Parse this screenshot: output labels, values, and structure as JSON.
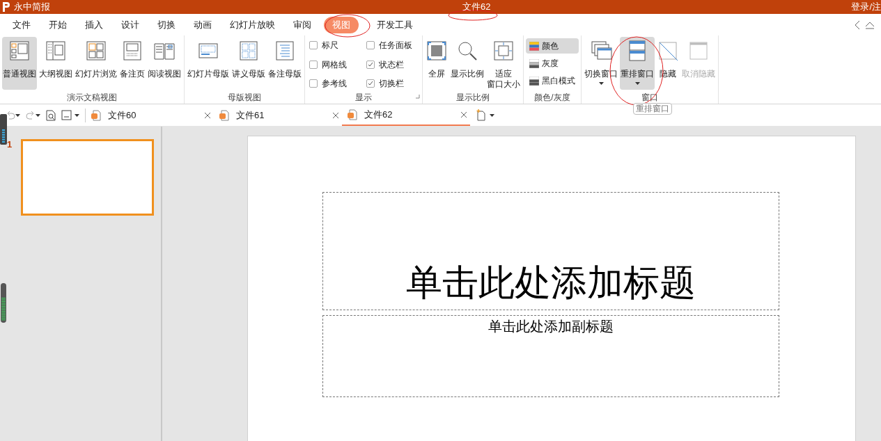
{
  "title_bar": {
    "app_name": "永中简报",
    "document_title": "文件62",
    "account_link": "登录/注"
  },
  "menu_tabs": [
    {
      "label": "文件",
      "selected": false
    },
    {
      "label": "开始",
      "selected": false
    },
    {
      "label": "插入",
      "selected": false
    },
    {
      "label": "设计",
      "selected": false
    },
    {
      "label": "切换",
      "selected": false
    },
    {
      "label": "动画",
      "selected": false
    },
    {
      "label": "幻灯片放映",
      "selected": false
    },
    {
      "label": "审阅",
      "selected": false
    },
    {
      "label": "视图",
      "selected": true
    },
    {
      "label": "开发工具",
      "selected": false
    }
  ],
  "ribbon": {
    "groups": [
      {
        "label": "演示文稿视图",
        "kind": "buttons",
        "items": [
          {
            "label": "普通视图",
            "selected": true
          },
          {
            "label": "大纲视图",
            "selected": false
          },
          {
            "label": "幻灯片浏览",
            "selected": false
          },
          {
            "label": "备注页",
            "selected": false
          },
          {
            "label": "阅读视图",
            "selected": false
          }
        ]
      },
      {
        "label": "母版视图",
        "kind": "buttons",
        "items": [
          {
            "label": "幻灯片母版",
            "selected": false
          },
          {
            "label": "讲义母版",
            "selected": false
          },
          {
            "label": "备注母版",
            "selected": false
          }
        ]
      },
      {
        "label": "显示",
        "kind": "checks",
        "items": [
          {
            "label": "标尺",
            "checked": false
          },
          {
            "label": "任务面板",
            "checked": false
          },
          {
            "label": "网格线",
            "checked": false
          },
          {
            "label": "状态栏",
            "checked": true
          },
          {
            "label": "参考线",
            "checked": false
          },
          {
            "label": "切换栏",
            "checked": true
          }
        ]
      },
      {
        "label": "显示比例",
        "kind": "buttons",
        "items": [
          {
            "label": "全屏",
            "selected": false
          },
          {
            "label": "显示比例",
            "selected": false
          },
          {
            "lines": [
              "适应",
              "窗口大小"
            ],
            "selected": false
          }
        ]
      },
      {
        "label": "颜色/灰度",
        "kind": "modes",
        "items": [
          {
            "label": "颜色",
            "selected": true
          },
          {
            "label": "灰度",
            "selected": false
          },
          {
            "label": "黑白模式",
            "selected": false
          }
        ]
      },
      {
        "label": "窗口",
        "kind": "buttons",
        "items": [
          {
            "label": "切换窗口",
            "selected": false,
            "dropdown": true
          },
          {
            "label": "重排窗口",
            "selected": true,
            "dropdown": true
          },
          {
            "label": "隐藏",
            "selected": false
          },
          {
            "label": "取消隐藏",
            "selected": false,
            "disabled": true
          }
        ]
      }
    ]
  },
  "tooltip": "重排窗口",
  "document_tabs": [
    {
      "label": "文件60",
      "selected": false
    },
    {
      "label": "文件61",
      "selected": false
    },
    {
      "label": "文件62",
      "selected": true
    }
  ],
  "thumbnails": [
    {
      "number": "1",
      "selected": true
    }
  ],
  "slide": {
    "title_placeholder": "单击此处添加标题",
    "subtitle_placeholder": "单击此处添加副标题"
  }
}
